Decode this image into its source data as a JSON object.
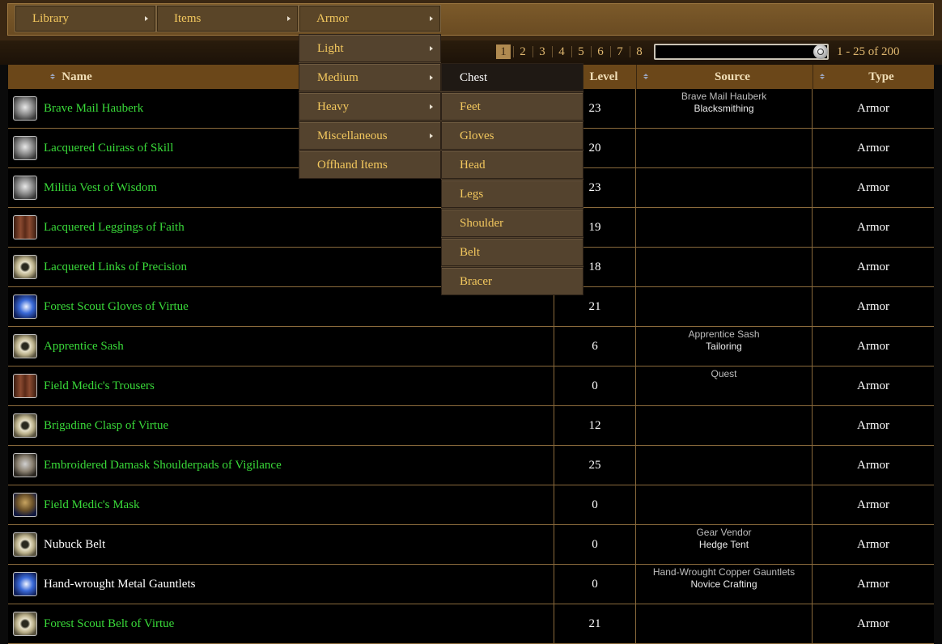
{
  "nav": {
    "library": "Library",
    "items": "Items",
    "armor": "Armor"
  },
  "armor_menu": [
    "Light",
    "Medium",
    "Heavy",
    "Miscellaneous",
    "Offhand Items"
  ],
  "medium_menu": [
    "Chest",
    "Feet",
    "Gloves",
    "Head",
    "Legs",
    "Shoulder",
    "Belt",
    "Bracer"
  ],
  "pagination": {
    "pages": [
      "1",
      "2",
      "3",
      "4",
      "5",
      "6",
      "7",
      "8"
    ],
    "current": "1",
    "range": "1 - 25 of 200"
  },
  "search": {
    "value": ""
  },
  "table": {
    "headers": {
      "name": "Name",
      "level": "Level",
      "source": "Source",
      "type": "Type"
    },
    "rows": [
      {
        "icon": "chest-armor-icon",
        "name": "Brave Mail Hauberk",
        "color": "green",
        "level": "23",
        "source1": "Brave Mail Hauberk",
        "source2": "Blacksmithing",
        "type": "Armor"
      },
      {
        "icon": "chest-armor-icon",
        "name": "Lacquered Cuirass of Skill",
        "color": "green",
        "level": "20",
        "source1": "",
        "source2": "",
        "type": "Armor"
      },
      {
        "icon": "chest-armor-icon",
        "name": "Militia Vest of Wisdom",
        "color": "green",
        "level": "23",
        "source1": "",
        "source2": "",
        "type": "Armor"
      },
      {
        "icon": "leggings-icon",
        "name": "Lacquered Leggings of Faith",
        "color": "green",
        "level": "19",
        "source1": "",
        "source2": "",
        "type": "Armor"
      },
      {
        "icon": "belt-icon",
        "name": "Lacquered Links of Precision",
        "color": "green",
        "level": "18",
        "source1": "",
        "source2": "",
        "type": "Armor"
      },
      {
        "icon": "gloves-icon",
        "name": "Forest Scout Gloves of Virtue",
        "color": "green",
        "level": "21",
        "source1": "",
        "source2": "",
        "type": "Armor"
      },
      {
        "icon": "belt-icon",
        "name": "Apprentice Sash",
        "color": "green",
        "level": "6",
        "source1": "Apprentice Sash",
        "source2": "Tailoring",
        "type": "Armor"
      },
      {
        "icon": "leggings-icon",
        "name": "Field Medic's Trousers",
        "color": "green",
        "level": "0",
        "source1": "Quest",
        "source2": "",
        "type": "Armor"
      },
      {
        "icon": "belt-icon",
        "name": "Brigadine Clasp of Virtue",
        "color": "green",
        "level": "12",
        "source1": "",
        "source2": "",
        "type": "Armor"
      },
      {
        "icon": "shoulder-icon",
        "name": "Embroidered Damask Shoulderpads of Vigilance",
        "color": "green",
        "level": "25",
        "source1": "",
        "source2": "",
        "type": "Armor"
      },
      {
        "icon": "mask-icon",
        "name": "Field Medic's Mask",
        "color": "green",
        "level": "0",
        "source1": "",
        "source2": "",
        "type": "Armor"
      },
      {
        "icon": "belt-icon",
        "name": "Nubuck Belt",
        "color": "white",
        "level": "0",
        "source1": "Gear Vendor",
        "source2": "Hedge Tent",
        "type": "Armor"
      },
      {
        "icon": "gloves-icon",
        "name": "Hand-wrought Metal Gauntlets",
        "color": "white",
        "level": "0",
        "source1": "Hand-Wrought Copper Gauntlets",
        "source2": "Novice Crafting",
        "type": "Armor"
      },
      {
        "icon": "belt-icon",
        "name": "Forest Scout Belt of Virtue",
        "color": "green",
        "level": "21",
        "source1": "",
        "source2": "",
        "type": "Armor"
      }
    ]
  }
}
